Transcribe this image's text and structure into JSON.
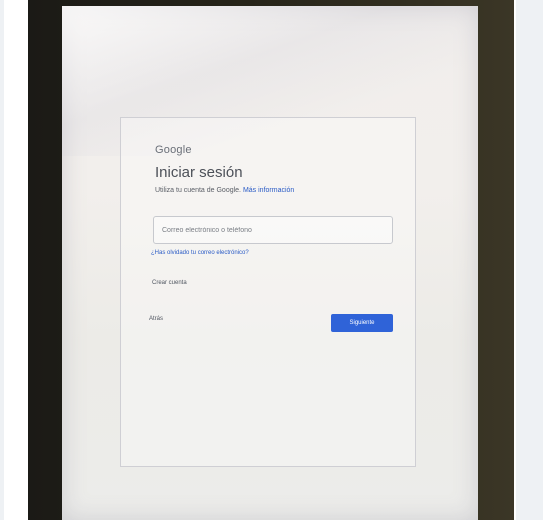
{
  "brand": "Google",
  "title": "Iniciar sesión",
  "subtitle": {
    "text": "Utiliza tu cuenta de Google.",
    "link": "Más información"
  },
  "email_field": {
    "placeholder": "Correo electrónico o teléfono",
    "value": ""
  },
  "forgot_email": "¿Has olvidado tu correo electrónico?",
  "create_account": "Crear cuenta",
  "back_label": "Atrás",
  "next_label": "Siguiente",
  "colors": {
    "primary_button": "#2f63d8",
    "link": "#2a5bc6"
  }
}
